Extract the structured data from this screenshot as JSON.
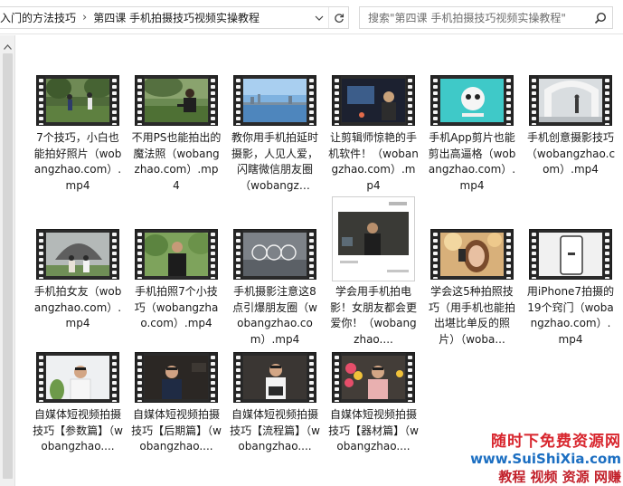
{
  "address": {
    "crumbs": [
      "入门的方法技巧",
      "第四课 手机拍摄技巧视频实操教程"
    ],
    "search_placeholder": "搜索\"第四课 手机拍摄技巧视频实操教程\""
  },
  "icons": {
    "dropdown": "chevron-down-icon",
    "refresh": "refresh-icon",
    "search": "search-icon",
    "scroll_up": "scroll-up-arrow-icon"
  },
  "files": [
    {
      "caption": "7个技巧，小白也能拍好照片（wobangzhao.com）.mp4",
      "scene": "park"
    },
    {
      "caption": "不用PS也能拍出的魔法照（wobangzhao.com）.mp4",
      "scene": "park-man"
    },
    {
      "caption": "教你用手机拍延时摄影，人见人爱，闪瞎微信朋友圈（wobangz…",
      "scene": "city-sea"
    },
    {
      "caption": "让剪辑师惊艳的手机软件！（wobangzhao.com）.mp4",
      "scene": "night-desk"
    },
    {
      "caption": "手机App剪片也能剪出高逼格（wobangzhao.com）.mp4",
      "scene": "logo-cyan"
    },
    {
      "caption": "手机创意摄影技巧（wobangzhao.com）.mp4",
      "scene": "white-arch"
    },
    {
      "caption": "手机拍女友（wobangzhao.com）.mp4",
      "scene": "statue-couple"
    },
    {
      "caption": "手机拍照7个小技巧（wobangzhao.com）.mp4",
      "scene": "man-garden"
    },
    {
      "caption": "手机摄影注意这8点引爆朋友圈（wobangzhao.com）.mp4",
      "scene": "gray-rings"
    },
    {
      "caption": "学会用手机拍电影！女朋友都会更爱你！（wobangzhao....",
      "scene": "doc-page"
    },
    {
      "caption": "学会这5种拍照技巧（用手机也能拍出堪比单反的照片）（woba...",
      "scene": "girl-phone"
    },
    {
      "caption": "用iPhone7拍摄的19个窍门（wobangzhao.com）.mp4",
      "scene": "iphone"
    },
    {
      "caption": "自媒体短视频拍摄技巧【参数篇】（wobangzhao....",
      "scene": "host-white"
    },
    {
      "caption": "自媒体短视频拍摄技巧【后期篇】（wobangzhao....",
      "scene": "host-dark"
    },
    {
      "caption": "自媒体短视频拍摄技巧【流程篇】（wobangzhao....",
      "scene": "host-cam"
    },
    {
      "caption": "自媒体短视频拍摄技巧【器材篇】（wobangzhao....",
      "scene": "host-flowers"
    }
  ],
  "watermark": {
    "line1": "随时下免费资源网",
    "line2": "www.SuiShiXia.com",
    "line3": "教程 视频 资源 网赚"
  },
  "colors": {
    "watermark_red": "#d8262e",
    "watermark_blue": "#1c6fc2"
  }
}
